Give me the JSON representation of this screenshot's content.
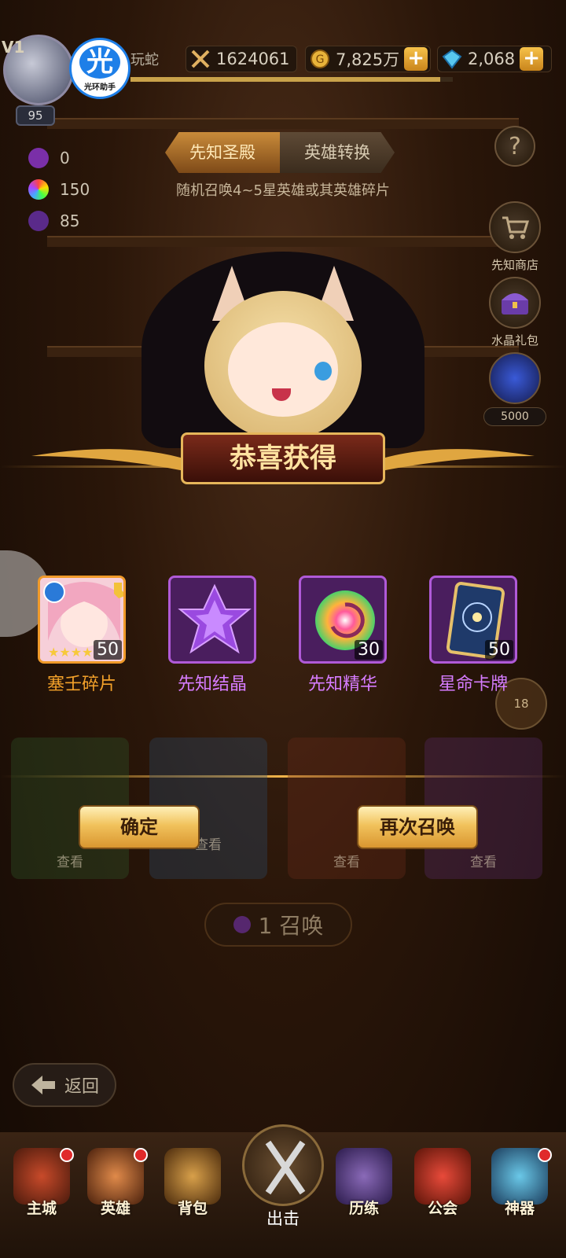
{
  "player": {
    "vip": "V1",
    "level": "95",
    "name_partial": "玩蛇",
    "xp_fraction": 0.96
  },
  "helper": {
    "main": "光",
    "sub": "光环助手"
  },
  "currency": {
    "power": "1624061",
    "gold": "7,825万",
    "diamonds": "2,068"
  },
  "resources": [
    "0",
    "150",
    "85"
  ],
  "tabs": [
    {
      "label": "先知圣殿",
      "active": true
    },
    {
      "label": "英雄转换",
      "active": false
    }
  ],
  "subtitle": "随机召唤4~5星英雄或其英雄碎片",
  "side_buttons": {
    "shop": "先知商店",
    "gift": "水晶礼包",
    "cost": "5000"
  },
  "banner": "恭喜获得",
  "rewards": [
    {
      "label": "塞壬碎片",
      "qty": "50",
      "style": "orange"
    },
    {
      "label": "先知结晶",
      "qty": "",
      "style": "purple"
    },
    {
      "label": "先知精华",
      "qty": "30",
      "style": "purple"
    },
    {
      "label": "星命卡牌",
      "qty": "50",
      "style": "purple"
    }
  ],
  "ghost_labels": [
    "查看",
    "查看",
    "查看",
    "查看"
  ],
  "buttons": {
    "confirm": "确定",
    "again": "再次召唤"
  },
  "summon": {
    "count_label": "1 召唤"
  },
  "badge_count": "18",
  "back": "返回",
  "nav": [
    "主城",
    "英雄",
    "背包",
    "出击",
    "历练",
    "公会",
    "神器"
  ],
  "colors": {
    "gold_accent": "#f0b34a",
    "purple_frame": "#b05ad8",
    "orange_frame": "#f09a2a"
  }
}
